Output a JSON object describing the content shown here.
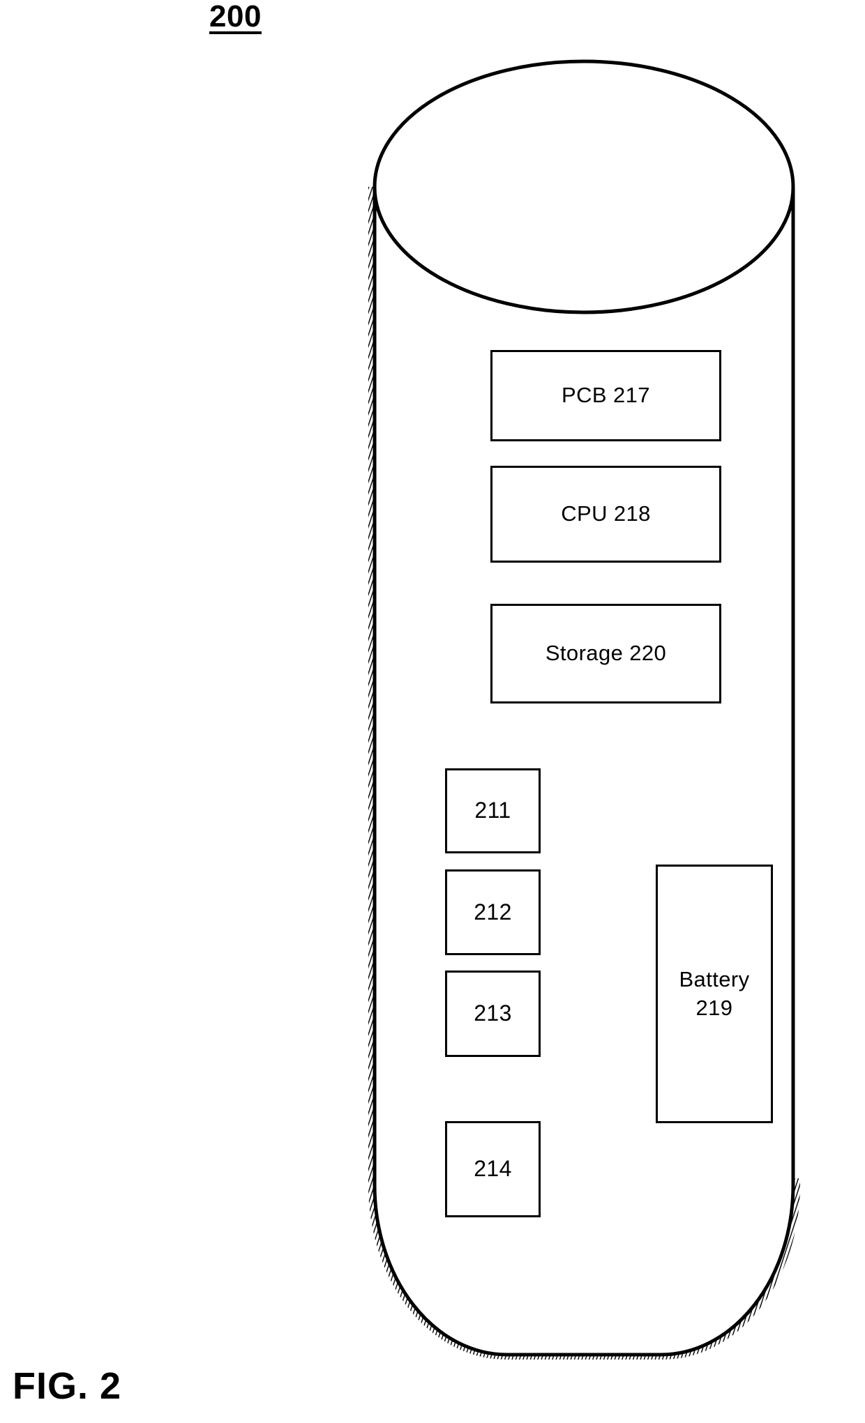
{
  "figure": {
    "reference_numeral": "200",
    "caption": "FIG. 2",
    "ink_color": "#000000",
    "background_color": "#ffffff"
  },
  "enclosure": {
    "name": "cylindrical-device-body",
    "shape": "cylinder",
    "shading": "stippled-outer-edge"
  },
  "components": [
    {
      "id": "pcb",
      "label": "PCB 217",
      "numeral": "217"
    },
    {
      "id": "cpu",
      "label": "CPU 218",
      "numeral": "218"
    },
    {
      "id": "storage",
      "label": "Storage 220",
      "numeral": "220"
    },
    {
      "id": "m211",
      "label": "211",
      "numeral": "211"
    },
    {
      "id": "m212",
      "label": "212",
      "numeral": "212"
    },
    {
      "id": "m213",
      "label": "213",
      "numeral": "213"
    },
    {
      "id": "m214",
      "label": "214",
      "numeral": "214"
    },
    {
      "id": "battery",
      "label": "Battery\n219",
      "numeral": "219"
    }
  ]
}
